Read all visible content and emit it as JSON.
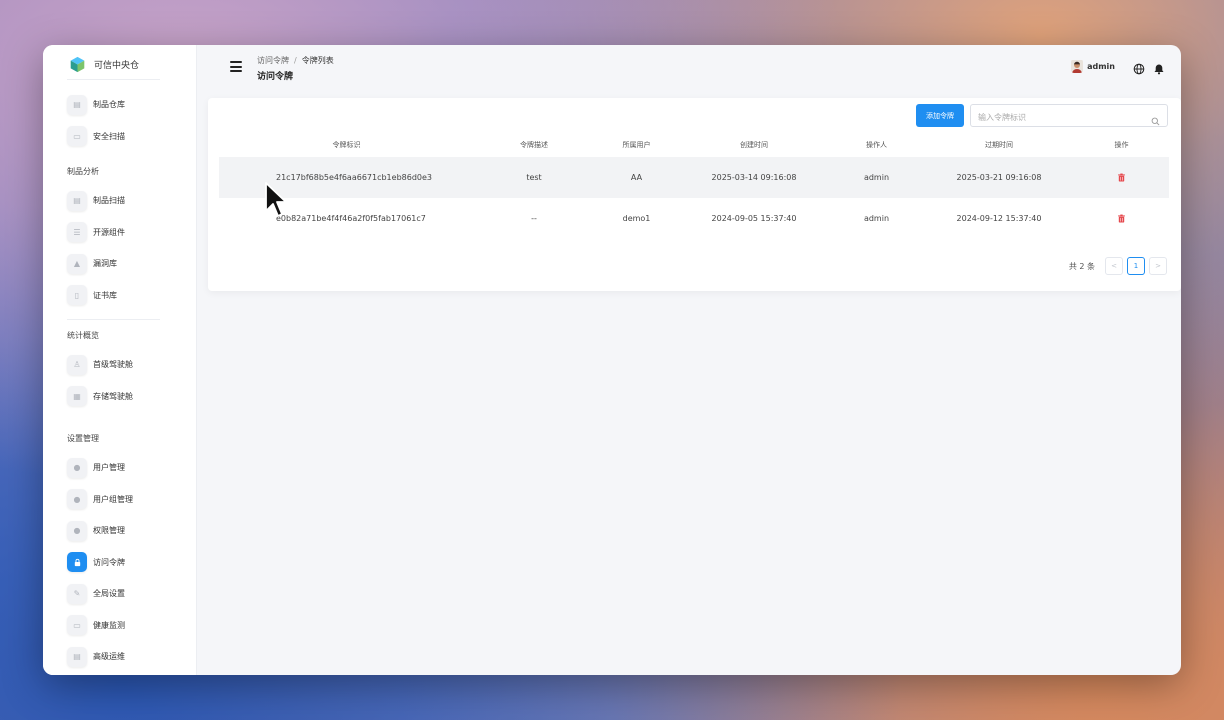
{
  "brand": {
    "name": "可信中央仓"
  },
  "sidebar": {
    "top_items": [
      {
        "label": "制品仓库",
        "icon": "box-icon"
      },
      {
        "label": "安全扫描",
        "icon": "scan-icon"
      }
    ],
    "groups": [
      {
        "title": "制品分析",
        "items": [
          {
            "label": "制品扫描",
            "icon": "scan-doc-icon"
          },
          {
            "label": "开源组件",
            "icon": "list-icon"
          },
          {
            "label": "漏洞库",
            "icon": "bug-icon"
          },
          {
            "label": "证书库",
            "icon": "cert-icon"
          }
        ]
      },
      {
        "title": "统计概览",
        "items": [
          {
            "label": "首级驾驶舱",
            "icon": "person-icon"
          },
          {
            "label": "存储驾驶舱",
            "icon": "grid-icon"
          }
        ]
      },
      {
        "title": "设置管理",
        "items": [
          {
            "label": "用户管理",
            "icon": "user-icon"
          },
          {
            "label": "用户组管理",
            "icon": "users-icon"
          },
          {
            "label": "权限管理",
            "icon": "shield-icon"
          },
          {
            "label": "访问令牌",
            "icon": "lock-icon",
            "active": true
          },
          {
            "label": "全局设置",
            "icon": "wrench-icon"
          },
          {
            "label": "健康监测",
            "icon": "monitor-icon"
          },
          {
            "label": "高级运维",
            "icon": "tools-icon"
          }
        ]
      }
    ]
  },
  "header": {
    "breadcrumb": [
      "访问令牌",
      "令牌列表"
    ],
    "title": "访问令牌",
    "username": "admin"
  },
  "toolbar": {
    "add_label": "添加令牌",
    "search_placeholder": "输入令牌标识"
  },
  "table": {
    "columns": [
      "令牌标识",
      "令牌描述",
      "所属用户",
      "创建时间",
      "操作人",
      "过期时间",
      "操作"
    ],
    "rows": [
      {
        "token": "21c17bf68b5e4f6aa6671cb1eb86d0e3",
        "desc": "test",
        "owner": "AA",
        "created": "2025-03-14 09:16:08",
        "operator": "admin",
        "expires": "2025-03-21 09:16:08"
      },
      {
        "token": "e0b82a71be4f4f46a2f0f5fab17061c7",
        "desc": "--",
        "owner": "demo1",
        "created": "2024-09-05 15:37:40",
        "operator": "admin",
        "expires": "2024-09-12 15:37:40"
      }
    ]
  },
  "pagination": {
    "total": "共 2 条",
    "current": "1",
    "prev": "<",
    "next": ">"
  },
  "colors": {
    "primary": "#1f8ef1",
    "danger": "#e5484d"
  }
}
